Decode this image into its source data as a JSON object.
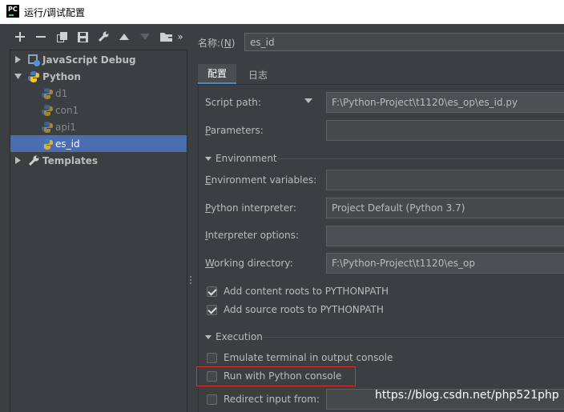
{
  "window": {
    "title": "运行/调试配置",
    "logo_text": "PC"
  },
  "toolbar": {
    "buttons": [
      "add-icon",
      "remove-icon",
      "copy-icon",
      "save-icon",
      "wrench-icon",
      "move-up-icon",
      "move-down-icon",
      "folder-icon",
      "more-icon"
    ],
    "more_label": "»"
  },
  "tree": [
    {
      "label": "JavaScript Debug",
      "level": 0,
      "expanded": false,
      "icon": "javascript-debug-icon"
    },
    {
      "label": "Python",
      "level": 0,
      "expanded": true,
      "icon": "python-icon"
    },
    {
      "label": "d1",
      "level": 1,
      "icon": "python-icon"
    },
    {
      "label": "con1",
      "level": 1,
      "icon": "python-icon"
    },
    {
      "label": "api1",
      "level": 1,
      "icon": "python-icon"
    },
    {
      "label": "es_id",
      "level": 1,
      "icon": "python-icon",
      "selected": true
    },
    {
      "label": "Templates",
      "level": 0,
      "expanded": false,
      "icon": "wrench-icon"
    }
  ],
  "name": {
    "label_prefix": "名称:(",
    "mnemonic": "N",
    "label_suffix": ")",
    "value": "es_id"
  },
  "tabs": [
    "配置",
    "日志"
  ],
  "fields": {
    "script_path": {
      "label": "Script path:",
      "value": "F:\\Python-Project\\t1120\\es_op\\es_id.py"
    },
    "parameters": {
      "label_first": "P",
      "label_rest": "arameters:",
      "value": ""
    },
    "environment_section": "Environment",
    "env_vars": {
      "label_first": "E",
      "label_rest": "nvironment variables:",
      "value": ""
    },
    "interpreter": {
      "label_first": "P",
      "label_rest": "ython interpreter:",
      "value": "Project Default (Python 3.7)"
    },
    "interpreter_options": {
      "label_first": "I",
      "label_rest": "nterpreter options:",
      "value": ""
    },
    "working_dir": {
      "label_first": "W",
      "label_rest": "orking directory:",
      "value": "F:\\Python-Project\\t1120\\es_op"
    },
    "execution_section": "Execution",
    "redirect_label": "Redirect input from:"
  },
  "checkboxes": [
    {
      "label": "Add content roots to PYTHONPATH",
      "checked": true
    },
    {
      "label": "Add source roots to PYTHONPATH",
      "checked": true
    },
    {
      "label": "Emulate terminal in output console",
      "checked": false
    },
    {
      "label": "Run with Python console",
      "checked": false
    },
    {
      "label": "Redirect input from:",
      "checked": false
    }
  ],
  "watermark": "https://blog.csdn.net/php521php",
  "colors": {
    "accent": "#4a88c7",
    "selection": "#4b6eaf",
    "highlight": "#e0312f",
    "background": "#3c3f41"
  }
}
